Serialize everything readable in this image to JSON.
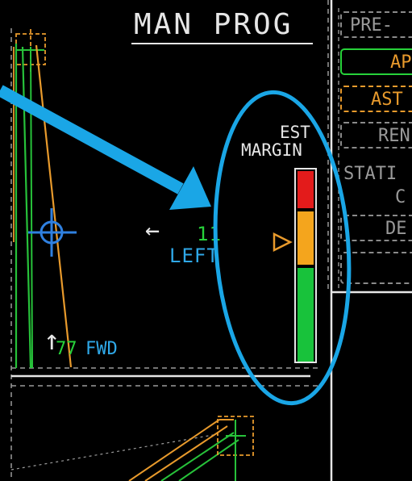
{
  "header": {
    "title": "MAN PROG"
  },
  "margin_indicator": {
    "label_line1": "EST",
    "label_line2": "MARGIN",
    "segments": [
      {
        "color": "#e31b1b"
      },
      {
        "color": "#f4a51d"
      },
      {
        "color": "#18c23b"
      }
    ],
    "pointer_color": "#e89a2c"
  },
  "lateral": {
    "arrow": "←",
    "value": "11",
    "direction": "LEFT"
  },
  "longitudinal": {
    "arrow": "↑",
    "value": "77",
    "direction": "FWD"
  },
  "side_menu": {
    "items": [
      {
        "label": "PRE-",
        "style": "dashed-grey",
        "color": "#9a9a9a"
      },
      {
        "label": "AP",
        "style": "solid-green",
        "color": "#e89a2c"
      },
      {
        "label": "AST",
        "style": "dashed-orange",
        "color": "#e89a2c"
      },
      {
        "label": "REN",
        "style": "dashed-grey",
        "color": "#9a9a9a"
      },
      {
        "label": "STATI",
        "style": "none",
        "color": "#9a9a9a"
      },
      {
        "label": "C",
        "style": "none",
        "color": "#9a9a9a"
      },
      {
        "label": "DE",
        "style": "dashed-grey",
        "color": "#9a9a9a"
      },
      {
        "label": "",
        "style": "dashed-grey",
        "color": "#9a9a9a"
      }
    ]
  },
  "annotation": {
    "arrow_color": "#1aa6e6",
    "ellipse_color": "#1aa6e6"
  },
  "colors": {
    "cyan_text": "#2fa8e8",
    "green_text": "#27d23a",
    "orange": "#e89a2c",
    "green_line": "#27c23a",
    "grey": "#8a8a8a",
    "white": "#e6e6e6"
  }
}
